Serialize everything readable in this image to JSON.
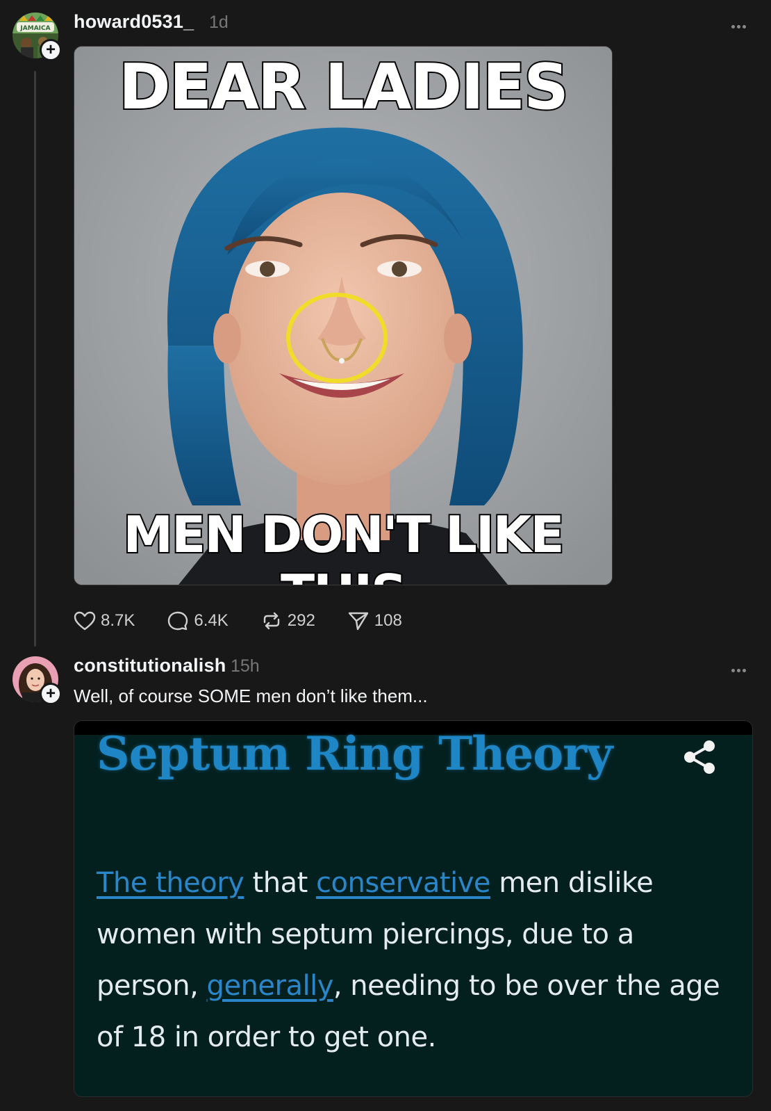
{
  "post1": {
    "username": "howard0531_",
    "time": "1d",
    "avatar_text": "JAMAICA",
    "meme": {
      "top_text": "DEAR LADIES",
      "bottom_text": "MEN DON'T LIKE THIS"
    },
    "actions": {
      "likes": "8.7K",
      "comments": "6.4K",
      "reposts": "292",
      "shares": "108"
    }
  },
  "post2": {
    "username": "constitutionalish",
    "time": "15h",
    "text": "Well, of course SOME men don’t like them...",
    "card": {
      "title": "Septum Ring Theory",
      "link1": "The theory",
      "text1": " that ",
      "link2": "conservative",
      "text2": " men dislike women with septum piercings, due to a person, ",
      "link3": "generally",
      "text3": ", needing to be over the age of 18 in order to get one."
    }
  },
  "icons": {
    "like": "heart-icon",
    "comment": "comment-bubble-icon",
    "repost": "repost-icon",
    "share": "send-icon",
    "more": "more-options-icon",
    "follow": "plus-icon"
  },
  "colors": {
    "background": "#181818",
    "text": "#f3f5f7",
    "muted": "#777777",
    "card_bg": "#03201f",
    "card_title": "#1f86c6",
    "highlight_circle": "#f2dc2a"
  }
}
